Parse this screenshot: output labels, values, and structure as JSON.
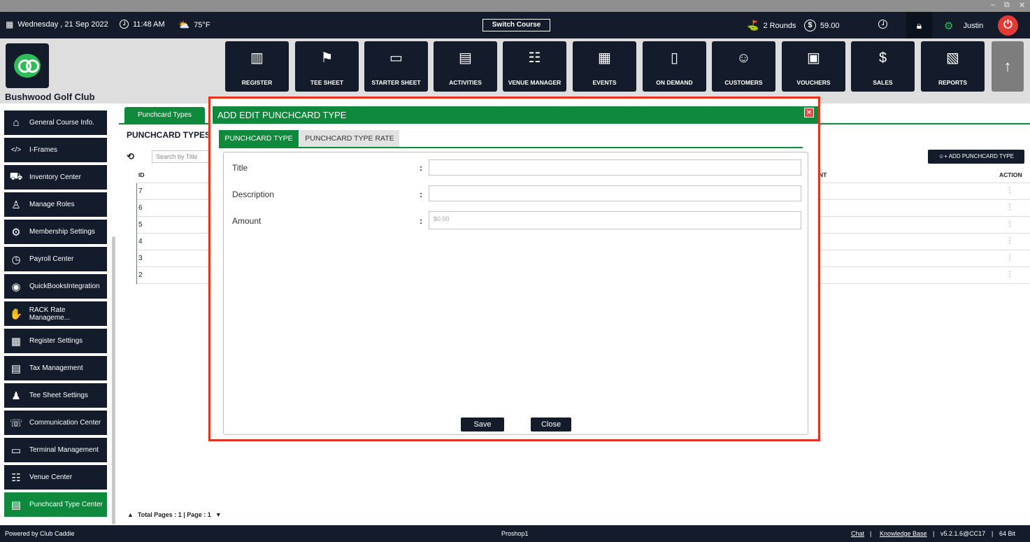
{
  "topbar": {
    "date": "Wednesday , 21 Sep 2022",
    "time": "11:48 AM",
    "weather": "75°F",
    "switch_course": "Switch Course",
    "rounds": "2 Rounds",
    "amount": "59.00",
    "user": "Justin"
  },
  "club": {
    "name": "Bushwood Golf Club"
  },
  "nav": {
    "items": [
      {
        "label": "REGISTER",
        "icon": "barcode-scanner-icon"
      },
      {
        "label": "TEE SHEET",
        "icon": "flag-icon"
      },
      {
        "label": "STARTER SHEET",
        "icon": "tablet-icon"
      },
      {
        "label": "ACTIVITIES",
        "icon": "calendar-list-icon"
      },
      {
        "label": "VENUE MANAGER",
        "icon": "venue-people-icon"
      },
      {
        "label": "EVENTS",
        "icon": "calendar-edit-icon"
      },
      {
        "label": "ON DEMAND",
        "icon": "phone-signal-icon"
      },
      {
        "label": "CUSTOMERS",
        "icon": "customers-icon"
      },
      {
        "label": "VOUCHERS",
        "icon": "voucher-icon"
      },
      {
        "label": "SALES",
        "icon": "money-icon"
      },
      {
        "label": "REPORTS",
        "icon": "report-icon"
      }
    ]
  },
  "sidebar": {
    "items": [
      {
        "label": "General Course Info.",
        "icon": "home-icon"
      },
      {
        "label": "I-Frames",
        "icon": "code-icon"
      },
      {
        "label": "Inventory Center",
        "icon": "cart-icon"
      },
      {
        "label": "Manage Roles",
        "icon": "org-chart-icon"
      },
      {
        "label": "Membership Settings",
        "icon": "settings-icon"
      },
      {
        "label": "Payroll Center",
        "icon": "clock-icon"
      },
      {
        "label": "QuickBooksIntegration",
        "icon": "quickbooks-icon"
      },
      {
        "label": "RACK Rate Manageme...",
        "icon": "rate-icon"
      },
      {
        "label": "Register Settings",
        "icon": "register-icon"
      },
      {
        "label": "Tax Management",
        "icon": "tax-icon"
      },
      {
        "label": "Tee Sheet Settings",
        "icon": "golf-pin-icon"
      },
      {
        "label": "Communication Center",
        "icon": "communication-icon"
      },
      {
        "label": "Terminal Management",
        "icon": "terminal-icon"
      },
      {
        "label": "Venue Center",
        "icon": "venue-icon"
      },
      {
        "label": "Punchcard Type Center",
        "icon": "punchcard-icon"
      }
    ]
  },
  "content": {
    "tab": "Punchcard Types",
    "heading": "PUNCHCARD TYPES",
    "search_placeholder": "Search by Title",
    "add_button": "ADD PUNCHCARD TYPE",
    "table": {
      "col_id": "ID",
      "col_amount_partial": "NT",
      "col_action": "ACTION",
      "rows": [
        "7",
        "6",
        "5",
        "4",
        "3",
        "2"
      ]
    },
    "pagination": "Total Pages : 1 | Page : 1"
  },
  "status": {
    "powered": "Powered by Club Caddie",
    "station": "Proshop1",
    "chat": "Chat",
    "kb": "Knowledge Base",
    "version": "v5.2.1.6@CC17",
    "bits": "64 Bit",
    "sep": "|"
  },
  "modal": {
    "title": "ADD EDIT PUNCHCARD TYPE",
    "tabs": [
      "PUNCHCARD TYPE",
      "PUNCHCARD TYPE RATE"
    ],
    "fields": [
      {
        "label": "Title",
        "value": "",
        "placeholder": ""
      },
      {
        "label": "Description",
        "value": "",
        "placeholder": ""
      },
      {
        "label": "Amount",
        "value": "",
        "placeholder": "$0.00"
      }
    ],
    "colon": ":",
    "save": "Save",
    "close": "Close"
  }
}
